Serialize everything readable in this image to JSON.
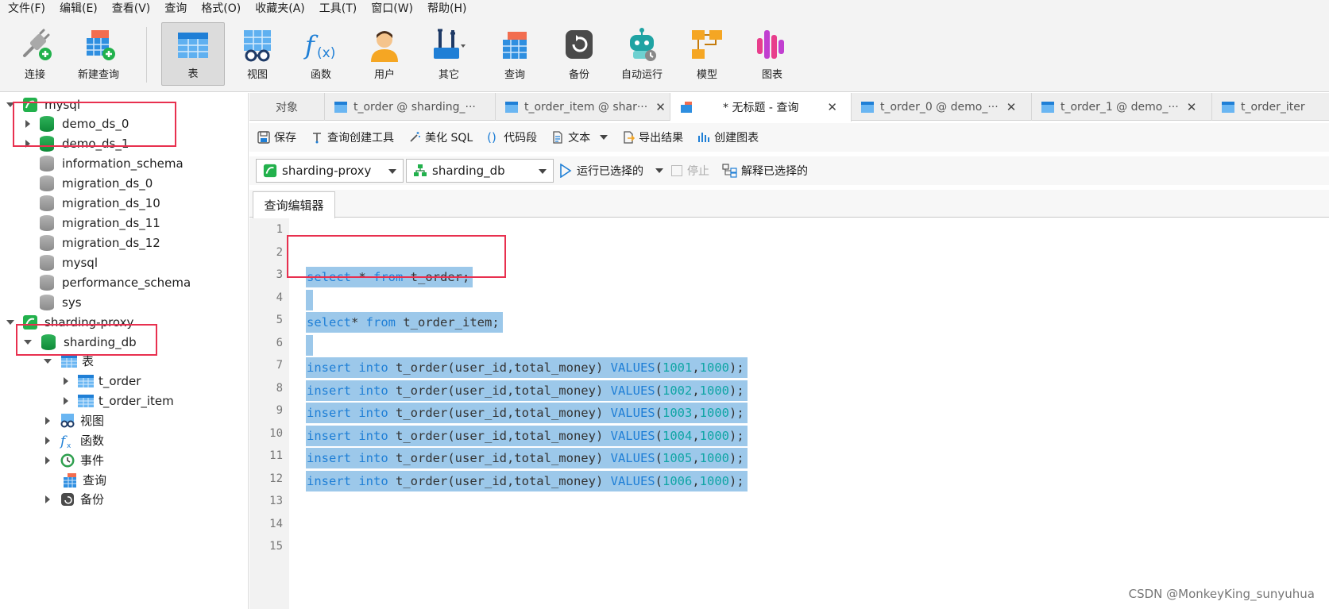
{
  "menu": [
    "文件(F)",
    "编辑(E)",
    "查看(V)",
    "查询",
    "格式(O)",
    "收藏夹(A)",
    "工具(T)",
    "窗口(W)",
    "帮助(H)"
  ],
  "toolbar": {
    "connect": "连接",
    "new_query": "新建查询",
    "table": "表",
    "view": "视图",
    "function": "函数",
    "user": "用户",
    "other": "其它",
    "query": "查询",
    "backup": "备份",
    "auto_run": "自动运行",
    "model": "模型",
    "chart": "图表"
  },
  "tree": {
    "mysql_conn": "mysql",
    "mysql_dbs": [
      "demo_ds_0",
      "demo_ds_1",
      "information_schema",
      "migration_ds_0",
      "migration_ds_10",
      "migration_ds_11",
      "migration_ds_12",
      "mysql",
      "performance_schema",
      "sys"
    ],
    "proxy_conn": "sharding-proxy",
    "proxy_db": "sharding_db",
    "tables_folder": "表",
    "tables": [
      "t_order",
      "t_order_item"
    ],
    "views": "视图",
    "functions": "函数",
    "events": "事件",
    "queries": "查询",
    "backups": "备份"
  },
  "tabs": {
    "objects": "对象",
    "t1": "t_order @ sharding_···",
    "t2": "t_order_item @ shar···",
    "t3": "* 无标题 - 查询",
    "t4": "t_order_0 @ demo_···",
    "t5": "t_order_1 @ demo_···",
    "t6": "t_order_iter"
  },
  "actions": {
    "save": "保存",
    "query_builder": "查询创建工具",
    "beautify": "美化 SQL",
    "snippet": "代码段",
    "text": "文本",
    "export": "导出结果",
    "create_chart": "创建图表"
  },
  "conn": {
    "connection": "sharding-proxy",
    "database": "sharding_db",
    "run_selected": "运行已选择的",
    "stop": "停止",
    "explain": "解释已选择的"
  },
  "subtab": "查询编辑器",
  "editor": {
    "line_numbers": [
      "1",
      "2",
      "3",
      "4",
      "5",
      "6",
      "7",
      "8",
      "9",
      "10",
      "11",
      "12",
      "13",
      "14",
      "15"
    ],
    "kw_select": "select",
    "kw_from": "from",
    "kw_insert": "insert",
    "kw_into": "into",
    "kw_values": "VALUES",
    "l3_star": " * ",
    "l3_table": " t_order;",
    "l5_star": "* ",
    "l5_table": " t_order_item;",
    "ins_cols": " t_order(user_id,total_money) ",
    "ins_vals": [
      [
        "1001",
        "1000"
      ],
      [
        "1002",
        "1000"
      ],
      [
        "1003",
        "1000"
      ],
      [
        "1004",
        "1000"
      ],
      [
        "1005",
        "1000"
      ],
      [
        "1006",
        "1000"
      ]
    ]
  },
  "watermark": "CSDN @MonkeyKing_sunyuhua",
  "colors": {
    "accent": "#1f7fd6",
    "number": "#0fa5a5",
    "selection": "#9cc8ea",
    "highlight_box": "#e8304f"
  }
}
